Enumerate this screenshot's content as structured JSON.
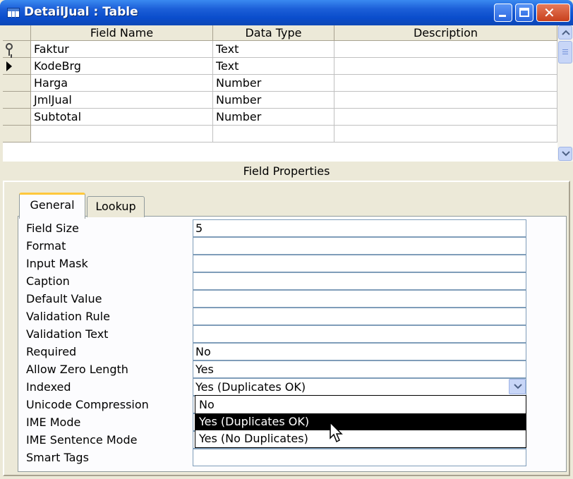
{
  "window": {
    "title": "DetailJual : Table"
  },
  "grid": {
    "columns": [
      "Field Name",
      "Data Type",
      "Description"
    ],
    "rows": [
      {
        "field": "Faktur",
        "type": "Text",
        "description": ""
      },
      {
        "field": "KodeBrg",
        "type": "Text",
        "description": ""
      },
      {
        "field": "Harga",
        "type": "Number",
        "description": ""
      },
      {
        "field": "JmlJual",
        "type": "Number",
        "description": ""
      },
      {
        "field": "Subtotal",
        "type": "Number",
        "description": ""
      },
      {
        "field": "",
        "type": "",
        "description": ""
      }
    ]
  },
  "field_properties": {
    "title": "Field Properties",
    "tabs": [
      "General",
      "Lookup"
    ],
    "properties": [
      {
        "label": "Field Size",
        "value": "5"
      },
      {
        "label": "Format",
        "value": ""
      },
      {
        "label": "Input Mask",
        "value": ""
      },
      {
        "label": "Caption",
        "value": ""
      },
      {
        "label": "Default Value",
        "value": ""
      },
      {
        "label": "Validation Rule",
        "value": ""
      },
      {
        "label": "Validation Text",
        "value": ""
      },
      {
        "label": "Required",
        "value": "No"
      },
      {
        "label": "Allow Zero Length",
        "value": "Yes"
      },
      {
        "label": "Indexed",
        "value": "Yes (Duplicates OK)"
      },
      {
        "label": "Unicode Compression",
        "value": ""
      },
      {
        "label": "IME Mode",
        "value": ""
      },
      {
        "label": "IME Sentence Mode",
        "value": ""
      },
      {
        "label": "Smart Tags",
        "value": ""
      }
    ],
    "dropdown": {
      "options": [
        "No",
        "Yes (Duplicates OK)",
        "Yes (No Duplicates)"
      ],
      "selected": "Yes (Duplicates OK)"
    }
  }
}
